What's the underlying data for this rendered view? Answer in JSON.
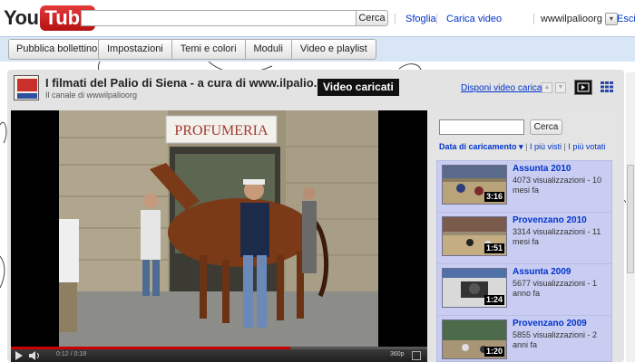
{
  "header": {
    "logo_you": "You",
    "logo_tube": "Tube",
    "search_value": "",
    "search_button": "Cerca",
    "nav_browse": "Sfoglia",
    "nav_upload": "Carica video",
    "username": "wwwilpalioorg",
    "user_menu_icon": "chevron-down-icon",
    "signout": "Esci"
  },
  "editor": {
    "publish_label": "Pubblica bollettino",
    "tabs": [
      {
        "label": "Impostazioni"
      },
      {
        "label": "Temi e colori"
      },
      {
        "label": "Moduli"
      },
      {
        "label": "Video e playlist"
      }
    ]
  },
  "channel": {
    "title": "I filmati del Palio di Siena - a cura di www.ilpalio.org",
    "subtitle": "Il canale di wwwilpalioorg",
    "uploaded_label": "Video caricati",
    "arrange_link": "Disponi video caricati"
  },
  "player": {
    "time": "0:12 / 0:18",
    "quality": "360p",
    "progress": 0.67,
    "sign_text": "PROFUMERIA"
  },
  "panel": {
    "search_value": "",
    "search_button": "Cerca",
    "sort_active": "Data di caricamento",
    "sort_most_viewed": "I più visti",
    "sort_top_rated": "I più votati",
    "videos": [
      {
        "title": "Assunta 2010",
        "meta": "4073 visualizzazioni - 10 mesi fa",
        "duration": "3:16"
      },
      {
        "title": "Provenzano 2010",
        "meta": "3314 visualizzazioni - 11 mesi fa",
        "duration": "1:51"
      },
      {
        "title": "Assunta 2009",
        "meta": "5677 visualizzazioni - 1 anno fa",
        "duration": "1:24"
      },
      {
        "title": "Provenzano 2009",
        "meta": "5855 visualizzazioni - 2 anni fa",
        "duration": "1:20"
      }
    ]
  },
  "colors": {
    "link": "#0033cc",
    "editor_bar": "#d8e6f5",
    "list_bg": "#c9cdf2",
    "progress": "#cc0000"
  }
}
